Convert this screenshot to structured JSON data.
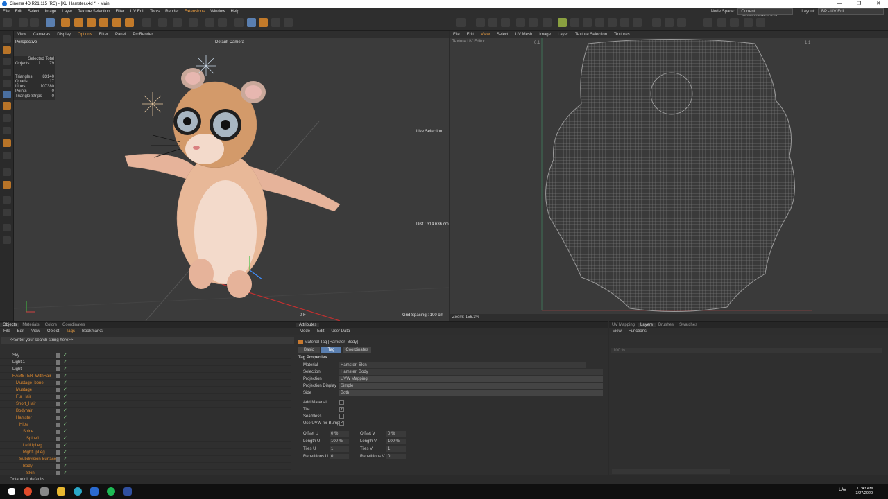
{
  "window": {
    "title": "Cinema 4D R21.115 (RC) - [KL_Hamster.c4d *] - Main"
  },
  "menu": [
    "File",
    "Edit",
    "Select",
    "Image",
    "Layer",
    "Texture Selection",
    "Filter",
    "UV Edit",
    "Tools",
    "Render",
    "Extensions",
    "Window",
    "Help"
  ],
  "node_space": {
    "label": "Node Space:",
    "value": "Current (Standard/Physical)"
  },
  "layout": {
    "label": "Layout:",
    "value": "BP - UV Edit"
  },
  "viewport": {
    "menu": [
      "View",
      "Cameras",
      "Display",
      "Options",
      "Filter",
      "Panel",
      "ProRender"
    ],
    "name": "Perspective",
    "camera": "Default Camera",
    "stats_header": "Selected Total",
    "objects": {
      "label": "Objects",
      "sel": "1",
      "total": "79"
    },
    "stats": [
      {
        "k": "Triangles",
        "v": "83140"
      },
      {
        "k": "Quads",
        "v": "17"
      },
      {
        "k": "Lines",
        "v": "107380"
      },
      {
        "k": "Points",
        "v": "0"
      },
      {
        "k": "Triangle Strips",
        "v": "0"
      }
    ],
    "live_selection": "Live Selection",
    "dist": "Dist : 314.636 cm",
    "grid_spacing": "Grid Spacing : 100 cm",
    "frame": "0 F"
  },
  "uv": {
    "menu": [
      "File",
      "Edit",
      "View",
      "Select",
      "UV Mesh",
      "Image",
      "Layer",
      "Texture Selection",
      "Textures"
    ],
    "title": "Texture UV Editor",
    "corner_tl": "0,1",
    "corner_tr": "1,1",
    "zoom": "Zoom: 156.3%"
  },
  "objects_panel": {
    "tabs": [
      "Objects",
      "Materials",
      "Colors",
      "Coordinates"
    ],
    "menu": [
      "File",
      "Edit",
      "View",
      "Object",
      "Tags",
      "Bookmarks"
    ],
    "search": "<<Enter your search string here>>",
    "rows": [
      {
        "name": "Sky",
        "indent": 0,
        "orange": false
      },
      {
        "name": "Light.1",
        "indent": 0,
        "orange": false
      },
      {
        "name": "Light",
        "indent": 0,
        "orange": false
      },
      {
        "name": "HAMSTER_WithHair",
        "indent": 0,
        "orange": true
      },
      {
        "name": "Mustage_bone",
        "indent": 1,
        "orange": true
      },
      {
        "name": "Mustage",
        "indent": 1,
        "orange": true
      },
      {
        "name": "Fur Hair",
        "indent": 1,
        "orange": true
      },
      {
        "name": "Short_Hair",
        "indent": 1,
        "orange": true
      },
      {
        "name": "Bodyhair",
        "indent": 1,
        "orange": true
      },
      {
        "name": "Hamster",
        "indent": 1,
        "orange": true
      },
      {
        "name": "Hips",
        "indent": 2,
        "orange": true
      },
      {
        "name": "Spine",
        "indent": 3,
        "orange": true
      },
      {
        "name": "Spine1",
        "indent": 4,
        "orange": true
      },
      {
        "name": "LeftUpLeg",
        "indent": 3,
        "orange": true
      },
      {
        "name": "RightUpLeg",
        "indent": 3,
        "orange": true
      },
      {
        "name": "Subdivision Surface",
        "indent": 2,
        "orange": true
      },
      {
        "name": "Body",
        "indent": 3,
        "orange": true
      },
      {
        "name": "Skin",
        "indent": 4,
        "orange": true
      }
    ]
  },
  "attributes": {
    "header": "Attributes",
    "menu": [
      "Mode",
      "Edit",
      "User Data"
    ],
    "tag_title": "Material Tag [Hamster_Body]",
    "tabs": [
      "Basic",
      "Tag",
      "Coordinates"
    ],
    "section": "Tag Properties",
    "material": {
      "k": "Material",
      "v": "Hamster_Skin"
    },
    "selection": {
      "k": "Selection",
      "v": "Hamster_Body"
    },
    "projection": {
      "k": "Projection",
      "v": "UVW Mapping"
    },
    "projection_display": {
      "k": "Projection Display",
      "v": "Simple"
    },
    "side": {
      "k": "Side",
      "v": "Both"
    },
    "add_material": {
      "k": "Add Material",
      "checked": false
    },
    "tile": {
      "k": "Tile",
      "checked": true
    },
    "seamless": {
      "k": "Seamless",
      "checked": false
    },
    "use_uvw_bump": {
      "k": "Use UVW for Bump",
      "checked": true
    },
    "offset_u": {
      "k": "Offset U",
      "v": "0 %"
    },
    "offset_v": {
      "k": "Offset V",
      "v": "0 %"
    },
    "length_u": {
      "k": "Length U",
      "v": "100 %"
    },
    "length_v": {
      "k": "Length V",
      "v": "100 %"
    },
    "tiles_u": {
      "k": "Tiles U",
      "v": "1"
    },
    "tiles_v": {
      "k": "Tiles V",
      "v": "1"
    },
    "repetitions_u": {
      "k": "Repetitions U",
      "v": "0"
    },
    "repetitions_v": {
      "k": "Repetitions V",
      "v": "0"
    }
  },
  "layers_panel": {
    "tabs": [
      "UV Mapping",
      "Layers",
      "Brushes",
      "Swatches"
    ],
    "menu": [
      "View",
      "Functions"
    ],
    "opacity": "100 %"
  },
  "status": "OctaneInit defaults",
  "taskbar": {
    "lang": "LAV",
    "time": "11:43 AM",
    "date": "3/27/2020"
  }
}
